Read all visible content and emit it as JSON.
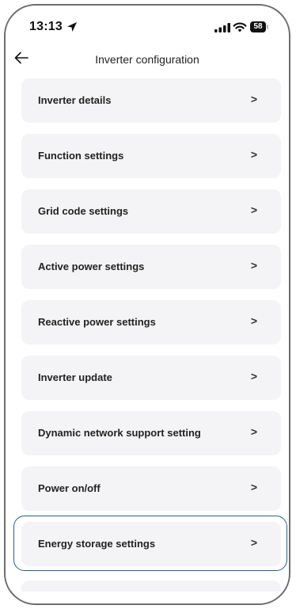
{
  "status_bar": {
    "time": "13:13",
    "battery": "58"
  },
  "header": {
    "title": "Inverter configuration"
  },
  "menu": {
    "items": [
      {
        "label": "Inverter details",
        "chevron": ">"
      },
      {
        "label": "Function settings",
        "chevron": ">"
      },
      {
        "label": "Grid code settings",
        "chevron": ">"
      },
      {
        "label": "Active power settings",
        "chevron": ">"
      },
      {
        "label": "Reactive power settings",
        "chevron": ">"
      },
      {
        "label": "Inverter update",
        "chevron": ">"
      },
      {
        "label": "Dynamic network support setting",
        "chevron": ">"
      },
      {
        "label": "Power on/off",
        "chevron": ">"
      },
      {
        "label": "Energy storage settings",
        "chevron": ">"
      }
    ],
    "highlighted_item": "Energy storage settings"
  },
  "colors": {
    "card_background": "#f4f4f6",
    "highlight_border": "#2a5d8f",
    "text": "#222222"
  },
  "icons": {
    "location": "location-arrow-icon",
    "signal": "signal-icon",
    "wifi": "wifi-icon",
    "battery": "battery-icon",
    "back": "back-arrow-icon"
  }
}
